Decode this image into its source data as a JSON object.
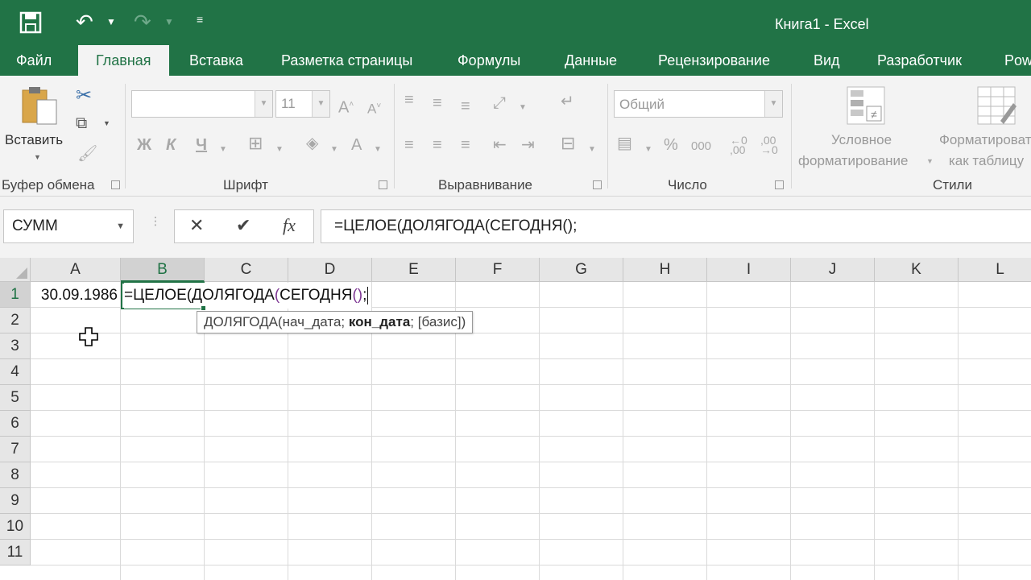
{
  "title_bar": {
    "window_title": "Книга1 - Excel",
    "icons": [
      "save-icon",
      "undo-icon",
      "redo-icon",
      "customize-qat-icon"
    ]
  },
  "tabs": [
    {
      "label": "Файл",
      "active": false
    },
    {
      "label": "Главная",
      "active": true
    },
    {
      "label": "Вставка",
      "active": false
    },
    {
      "label": "Разметка страницы",
      "active": false
    },
    {
      "label": "Формулы",
      "active": false
    },
    {
      "label": "Данные",
      "active": false
    },
    {
      "label": "Рецензирование",
      "active": false
    },
    {
      "label": "Вид",
      "active": false
    },
    {
      "label": "Разработчик",
      "active": false
    },
    {
      "label": "Pow",
      "active": false
    }
  ],
  "ribbon": {
    "clipboard": {
      "paste_label": "Вставить",
      "group_label": "Буфер обмена"
    },
    "font": {
      "font_name": "",
      "font_size": "11",
      "group_label": "Шрифт",
      "bold": "Ж",
      "italic": "К",
      "underline": "Ч",
      "font_color": "A"
    },
    "alignment": {
      "group_label": "Выравнивание"
    },
    "number": {
      "format": "Общий",
      "group_label": "Число",
      "percent": "%",
      "thousands": "000"
    },
    "styles": {
      "conditional_line1": "Условное",
      "conditional_line2": "форматирование",
      "table_line1": "Форматировать",
      "table_line2": "как таблицу",
      "group_label": "Стили"
    }
  },
  "formula_bar": {
    "name_box": "СУММ",
    "formula": "=ЦЕЛОЕ(ДОЛЯГОДА(СЕГОДНЯ();",
    "cancel": "✕",
    "enter": "✔",
    "fx": "fx"
  },
  "sheet": {
    "columns": [
      "A",
      "B",
      "C",
      "D",
      "E",
      "F",
      "G",
      "H",
      "I",
      "J",
      "K",
      "L"
    ],
    "selected_column": "B",
    "rows": [
      "1",
      "2",
      "3",
      "4",
      "5",
      "6",
      "7",
      "8",
      "9",
      "10",
      "11"
    ],
    "selected_row": "1",
    "cells": {
      "A1": "30.09.1986",
      "B1_part1": "=ЦЕЛОЕ(ДОЛЯГОДА",
      "B1_paren1": "(",
      "B1_part2": "СЕГОДНЯ",
      "B1_paren2": "()",
      "B1_part3": ";"
    },
    "tooltip": {
      "func": "ДОЛЯГОДА(",
      "arg1": "нач_дата; ",
      "arg2": "кон_дата",
      "arg3": "; [базис])"
    }
  },
  "colors": {
    "accent": "#217346",
    "ribbon_bg": "#f3f3f3",
    "header_bg": "#e6e6e6",
    "paren_purple": "#7e3794"
  }
}
